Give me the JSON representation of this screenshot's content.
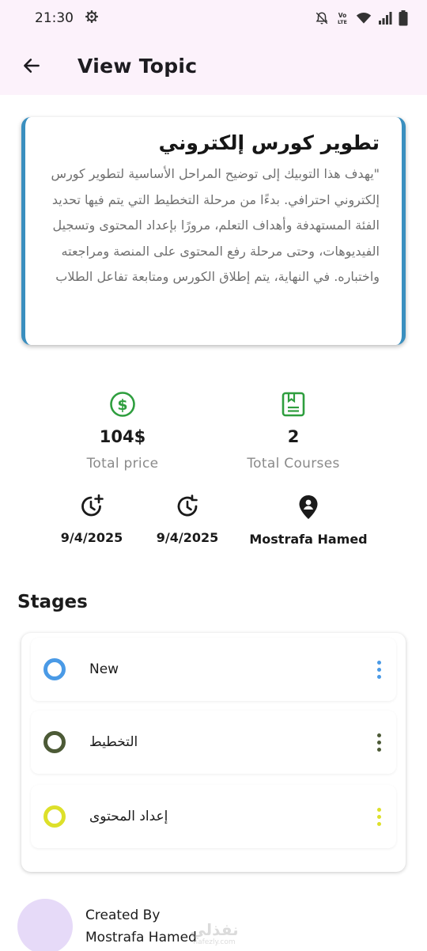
{
  "status_bar": {
    "time": "21:30",
    "icons": [
      "gear-icon",
      "mute-icon",
      "volte-icon",
      "wifi-icon",
      "signal-icon",
      "battery-icon"
    ],
    "volte_text": "VoLTE"
  },
  "app_bar": {
    "title": "View Topic",
    "back_icon": "arrow-left-icon"
  },
  "topic": {
    "title": "تطوير كورس إلكتروني",
    "description": "\"يهدف هذا التوبيك إلى توضيح المراحل الأساسية لتطوير كورس إلكتروني احترافي. بدءًا من مرحلة التخطيط التي يتم فيها تحديد الفئة المستهدفة وأهداف التعلم، مرورًا بإعداد المحتوى وتسجيل الفيديوهات، وحتى مرحلة رفع المحتوى على المنصة ومراجعته واختباره. في النهاية، يتم إطلاق الكورس ومتابعة تفاعل الطلاب",
    "accent_color": "#3a8fbf"
  },
  "stats": {
    "price": {
      "value": "104$",
      "label": "Total price",
      "icon": "dollar-circle-icon"
    },
    "courses": {
      "value": "2",
      "label": "Total Courses",
      "icon": "book-icon"
    }
  },
  "meta": {
    "created_date": {
      "value": "9/4/2025",
      "icon": "clock-plus-icon"
    },
    "updated_date": {
      "value": "9/4/2025",
      "icon": "clock-refresh-icon"
    },
    "owner": {
      "value": "Mostrafa Hamed",
      "icon": "location-person-icon"
    }
  },
  "stages": {
    "title": "Stages",
    "items": [
      {
        "label": "New",
        "color": "#4a9ae6"
      },
      {
        "label": "التخطيط",
        "color": "#4c5a36"
      },
      {
        "label": "إعداد المحتوى",
        "color": "#dde02a"
      }
    ]
  },
  "creator": {
    "caption": "Created By",
    "name": "Mostrafa Hamed",
    "avatar_color": "#e6daf8"
  },
  "watermark": {
    "logo": "نفذلي",
    "url": "nafezly.com"
  },
  "colors": {
    "primary_green": "#2e9e3e",
    "app_bar_bg": "#fcf2fb"
  }
}
